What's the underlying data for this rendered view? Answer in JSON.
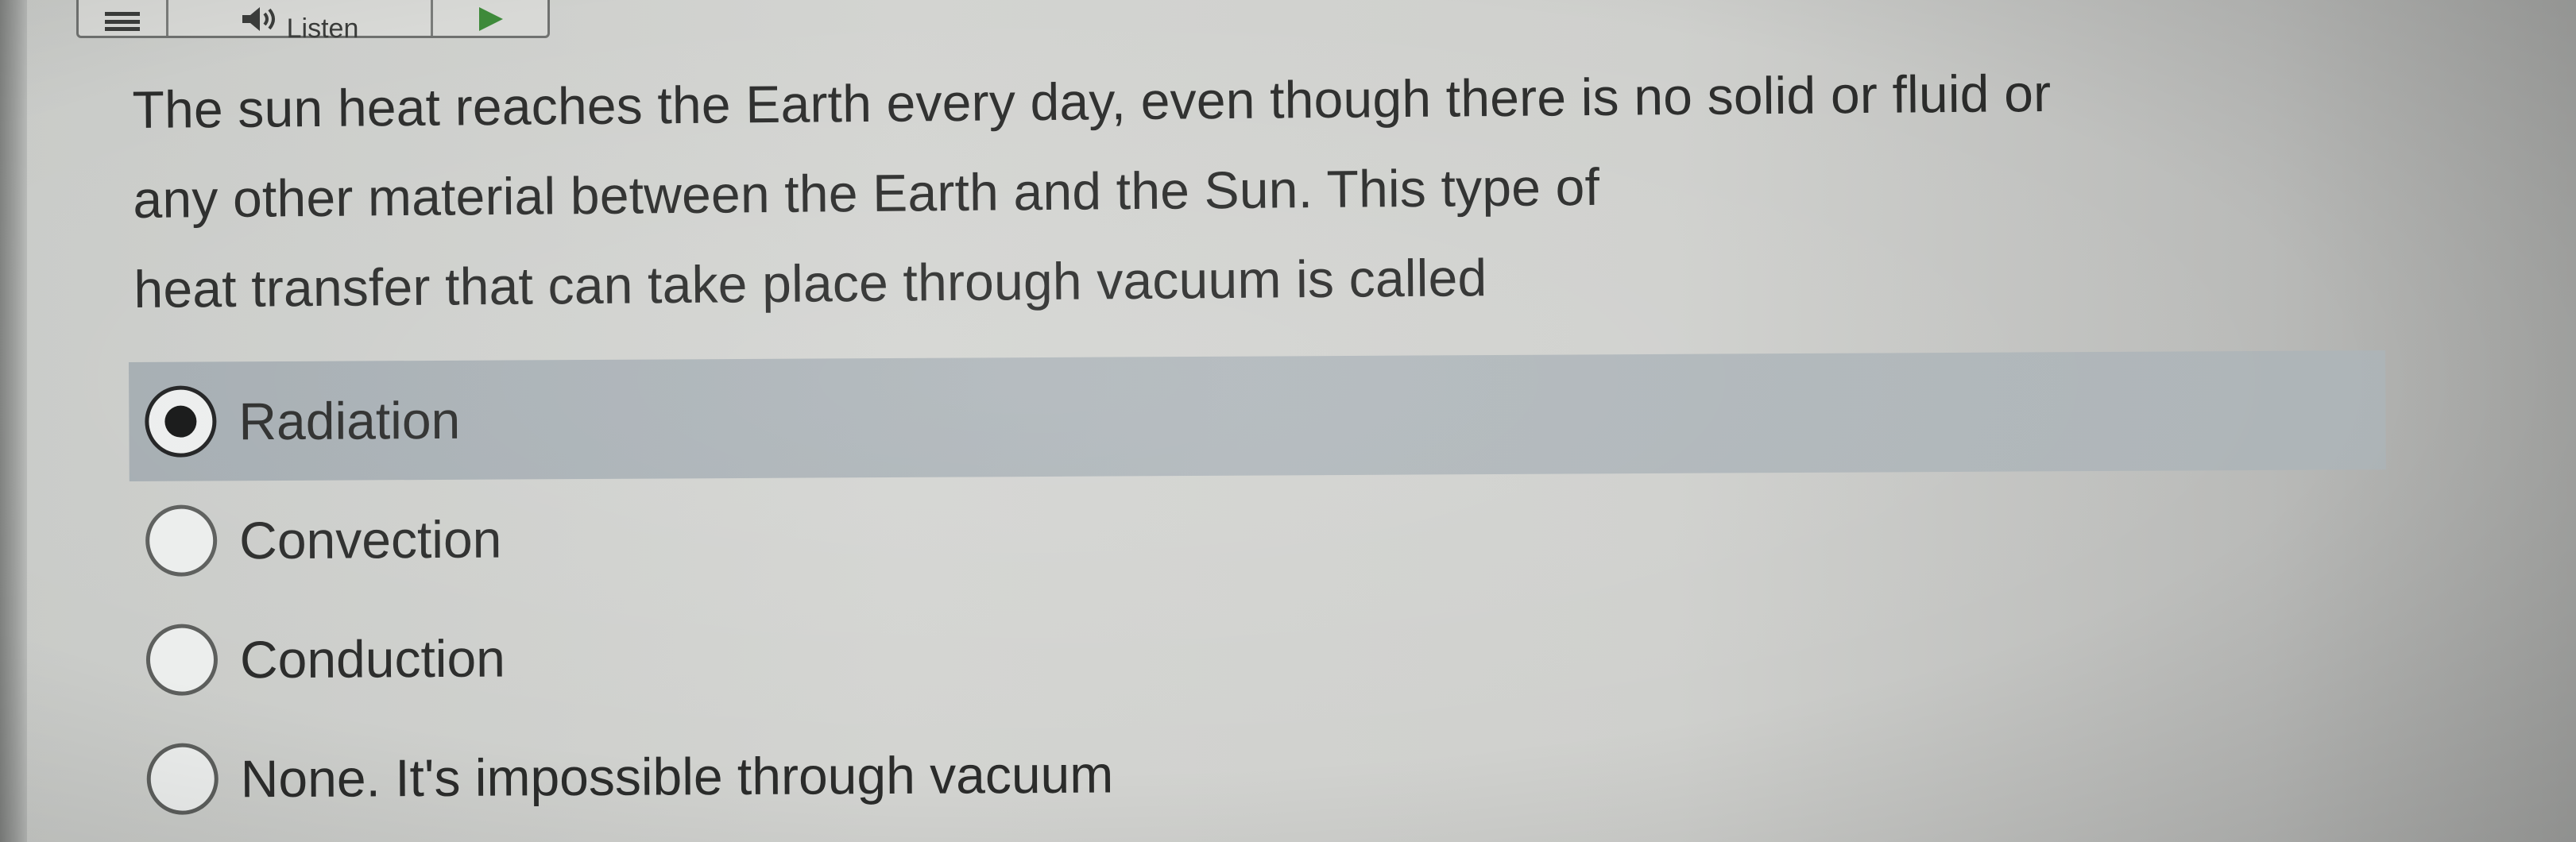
{
  "toolbar": {
    "menu_icon": "hamburger-icon",
    "speaker_icon": "speaker-icon",
    "listen_label": "Listen",
    "play_icon": "play-icon"
  },
  "question": {
    "lines": [
      "The sun heat reaches the Earth every day, even though there is no solid or fluid or",
      "any other material between the Earth and the Sun. This type of",
      "heat transfer that can take place through vacuum is called"
    ]
  },
  "options": [
    {
      "label": "Radiation",
      "selected": true
    },
    {
      "label": "Convection",
      "selected": false
    },
    {
      "label": "Conduction",
      "selected": false
    },
    {
      "label": "None. It's impossible through vacuum",
      "selected": false
    }
  ],
  "colors": {
    "text": "#2b2c2b",
    "selected_row": "#aeb5b8",
    "background": "#cfd0cd"
  }
}
